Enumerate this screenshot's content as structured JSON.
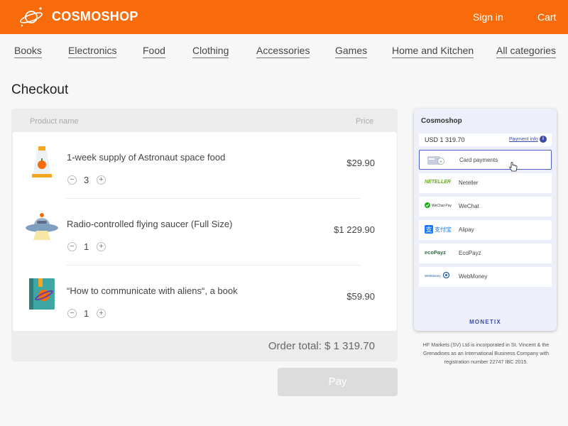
{
  "header": {
    "brand": "COSMOSHOP",
    "signin": "Sign in",
    "cart": "Cart",
    "bg_color": "#f76b0a"
  },
  "categories": [
    "Books",
    "Electronics",
    "Food",
    "Clothing",
    "Accessories",
    "Games",
    "Home and Kitchen",
    "All categories"
  ],
  "page_title": "Checkout",
  "cart_table": {
    "col_product": "Product name",
    "col_price": "Price",
    "items": [
      {
        "name": "1-week supply of Astronaut space food",
        "qty": "3",
        "price": "$29.90",
        "icon": "space-food-tube-icon"
      },
      {
        "name": "Radio-controlled flying saucer (Full Size)",
        "qty": "1",
        "price": "$1 229.90",
        "icon": "ufo-icon"
      },
      {
        "name": "“How to communicate with aliens“, a book",
        "qty": "1",
        "price": "$59.90",
        "icon": "book-icon"
      }
    ],
    "order_total": "Order total: $ 1 319.70"
  },
  "pay_button": "Pay",
  "payment_widget": {
    "title": "Cosmoshop",
    "amount": "USD  1 319.70",
    "info_link": "Payment info",
    "methods": [
      {
        "label": "Card payments",
        "logo": "",
        "selected": true
      },
      {
        "label": "Neteller",
        "logo": "NETELLER",
        "selected": false
      },
      {
        "label": "WeChat",
        "logo": "WeChat Pay",
        "selected": false
      },
      {
        "label": "Alipay",
        "logo": "支付宝",
        "selected": false
      },
      {
        "label": "EcoPayz",
        "logo": "ecoPayz",
        "selected": false
      },
      {
        "label": "WebMoney",
        "logo": "WebMoney",
        "selected": false
      }
    ],
    "footer": "MONETIX"
  },
  "legal_text": "HF Markets (SV) Ltd is incorporated in St. Vincent & the Grenadines as an International Business Company with registration number 22747 IBC 2015."
}
